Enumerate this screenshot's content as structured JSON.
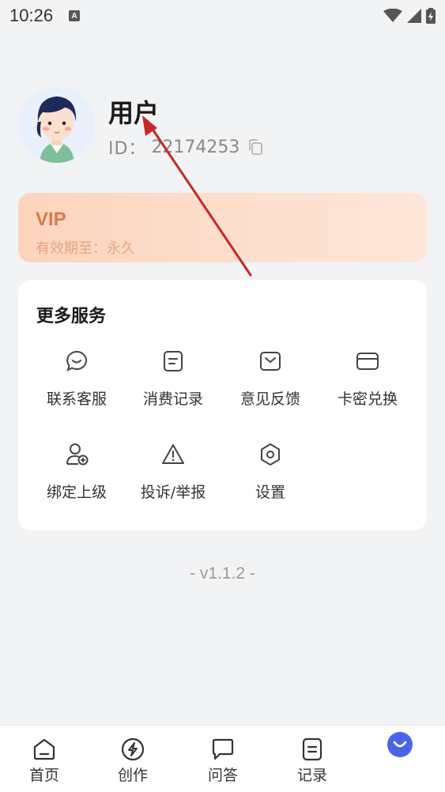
{
  "status_bar": {
    "time": "10:26",
    "notification_letter": "A"
  },
  "profile": {
    "name": "用户",
    "id_label": "ID：",
    "id_value": "22174253"
  },
  "vip": {
    "title": "VIP",
    "expire": "有效期至：永久"
  },
  "services": {
    "title": "更多服务",
    "items": [
      {
        "label": "联系客服",
        "icon": "chat-bubble-icon"
      },
      {
        "label": "消费记录",
        "icon": "receipt-icon"
      },
      {
        "label": "意见反馈",
        "icon": "mail-icon"
      },
      {
        "label": "卡密兑换",
        "icon": "card-icon"
      },
      {
        "label": "绑定上级",
        "icon": "add-user-icon"
      },
      {
        "label": "投诉/举报",
        "icon": "warning-icon"
      },
      {
        "label": "设置",
        "icon": "settings-hexagon-icon"
      }
    ]
  },
  "version": "- v1.1.2 -",
  "bottom_nav": {
    "items": [
      {
        "label": "首页",
        "icon": "home-icon"
      },
      {
        "label": "创作",
        "icon": "lightning-icon"
      },
      {
        "label": "问答",
        "icon": "chat-icon"
      },
      {
        "label": "记录",
        "icon": "document-icon"
      },
      {
        "label": "",
        "icon": "profile-smile-icon",
        "active": true
      }
    ]
  },
  "colors": {
    "accent": "#4b63e8",
    "vip_text": "#d9794a",
    "annotation_arrow": "#c62828",
    "background": "#f2f3f5"
  }
}
